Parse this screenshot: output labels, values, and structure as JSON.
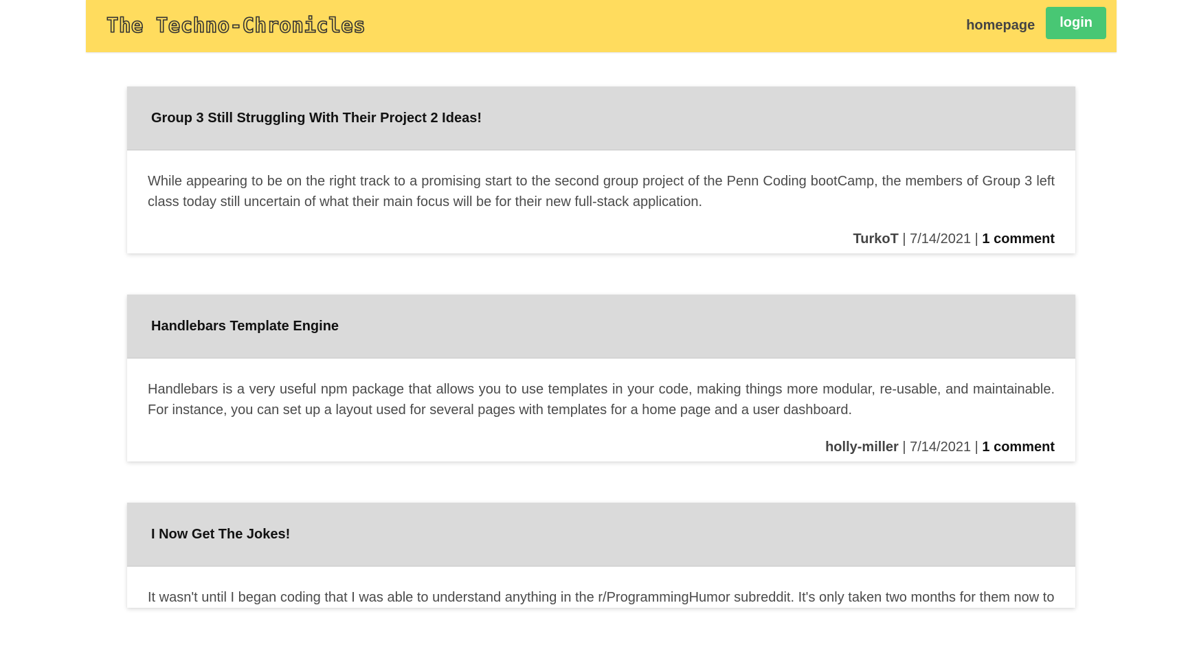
{
  "header": {
    "site_title": "The Techno-Chronicles",
    "nav_homepage": "homepage",
    "nav_login": "login"
  },
  "colors": {
    "header_bg": "#ffdc5e",
    "login_bg": "#48c774",
    "card_header_bg": "#dadada"
  },
  "posts": [
    {
      "title": "Group 3 Still Struggling With Their Project 2 Ideas!",
      "content": "While appearing to be on the right track to a promising start to the second group project of the Penn Coding bootCamp, the members of Group 3 left class today still uncertain of what their main focus will be for their new full-stack application.",
      "author": "TurkoT",
      "sep1": " | ",
      "date": "7/14/2021",
      "sep2": " | ",
      "comments": "1 comment"
    },
    {
      "title": "Handlebars Template Engine",
      "content": "Handlebars is a very useful npm package that allows you to use templates in your code, making things more modular, re-usable, and maintainable. For instance, you can set up a layout used for several pages with templates for a home page and a user dashboard.",
      "author": "holly-miller",
      "sep1": " | ",
      "date": "7/14/2021",
      "sep2": " | ",
      "comments": "1 comment"
    },
    {
      "title": "I Now Get The Jokes!",
      "content": "It wasn't until I began coding that I was able to understand anything in the r/ProgrammingHumor subreddit. It's only taken two months for them now to"
    }
  ]
}
